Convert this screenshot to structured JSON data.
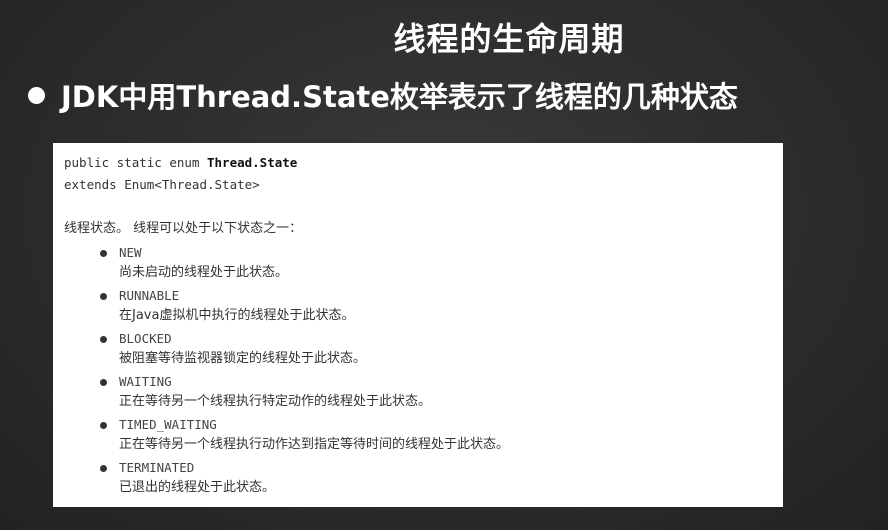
{
  "slide": {
    "title": "线程的生命周期",
    "headline": "JDK中用Thread.State枚举表示了线程的几种状态"
  },
  "code": {
    "decl_prefix": "public static enum ",
    "decl_class": "Thread.State",
    "extends_line": "extends Enum<Thread.State>",
    "intro": "线程状态。 线程可以处于以下状态之一："
  },
  "states": [
    {
      "name": "NEW",
      "desc": "尚未启动的线程处于此状态。"
    },
    {
      "name": "RUNNABLE",
      "desc": "在Java虚拟机中执行的线程处于此状态。"
    },
    {
      "name": "BLOCKED",
      "desc": "被阻塞等待监视器锁定的线程处于此状态。"
    },
    {
      "name": "WAITING",
      "desc": "正在等待另一个线程执行特定动作的线程处于此状态。"
    },
    {
      "name": "TIMED_WAITING",
      "desc": "正在等待另一个线程执行动作达到指定等待时间的线程处于此状态。"
    },
    {
      "name": "TERMINATED",
      "desc": "已退出的线程处于此状态。"
    }
  ]
}
